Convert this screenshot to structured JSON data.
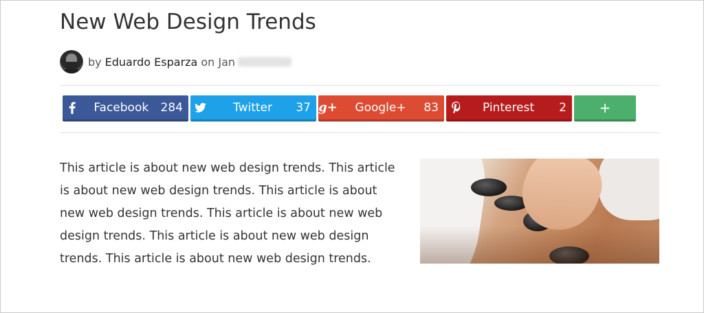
{
  "post": {
    "title": "New Web Design Trends",
    "byline_prefix": "by",
    "author": "Eduardo Esparza",
    "date_prefix": "on Jan"
  },
  "share_bar": {
    "facebook": {
      "label": "Facebook",
      "count": "284",
      "icon": "facebook-f-icon",
      "color": "#3b5998"
    },
    "twitter": {
      "label": "Twitter",
      "count": "37",
      "icon": "twitter-bird-icon",
      "color": "#1ea1e8"
    },
    "googleplus": {
      "label": "Google+",
      "count": "83",
      "icon": "google-plus-icon",
      "icon_text": "g+",
      "color": "#dd4b33"
    },
    "pinterest": {
      "label": "Pinterest",
      "count": "2",
      "icon": "pinterest-p-icon",
      "color": "#b71c1c"
    },
    "more": {
      "label": "+",
      "color": "#4caf6c"
    }
  },
  "article": {
    "body": "This article is about new web design trends. This article is about new web design trends. This article is about new web design trends. This article is about new web design trends. This article is about new web design trends. This article is about new web design trends."
  }
}
